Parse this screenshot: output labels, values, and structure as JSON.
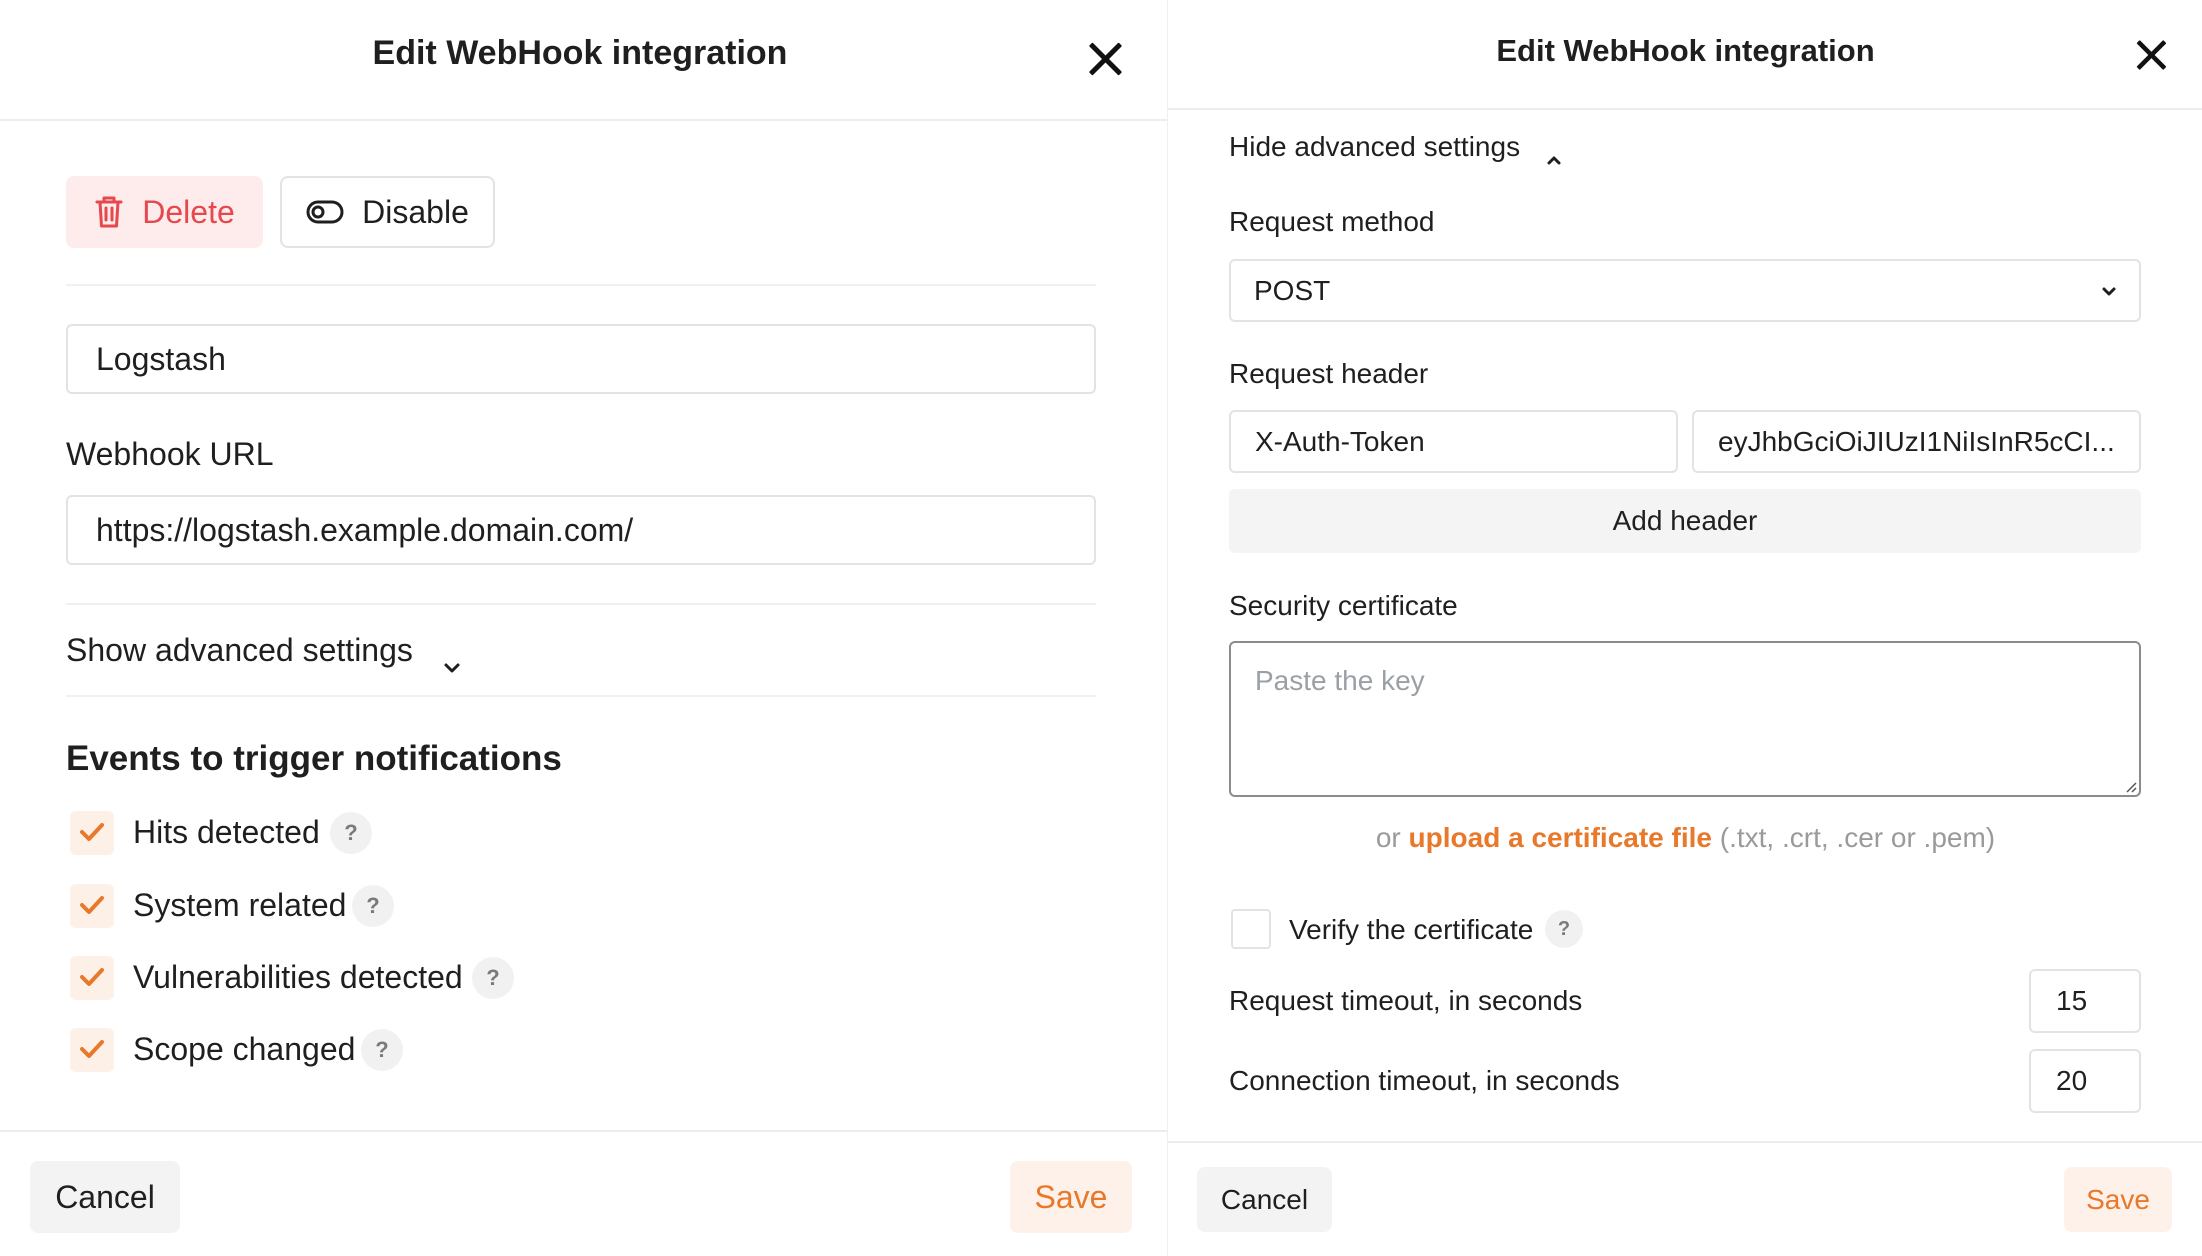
{
  "left": {
    "title": "Edit WebHook integration",
    "delete_label": "Delete",
    "disable_label": "Disable",
    "name_value": "Logstash",
    "url_label": "Webhook URL",
    "url_value": "https://logstash.example.domain.com/",
    "advanced_toggle": "Show advanced settings",
    "events_heading": "Events to trigger notifications",
    "events": [
      {
        "label": "Hits detected",
        "checked": true
      },
      {
        "label": "System related",
        "checked": true
      },
      {
        "label": "Vulnerabilities detected",
        "checked": true
      },
      {
        "label": "Scope changed",
        "checked": true
      }
    ],
    "help_glyph": "?",
    "cancel_label": "Cancel",
    "save_label": "Save"
  },
  "right": {
    "title": "Edit WebHook integration",
    "advanced_toggle": "Hide advanced settings",
    "method_label": "Request method",
    "method_value": "POST",
    "header_label": "Request header",
    "header_name": "X-Auth-Token",
    "header_value": "eyJhbGciOiJIUzI1NiIsInR5cCI...",
    "add_header_label": "Add header",
    "cert_label": "Security certificate",
    "cert_placeholder": "Paste the key",
    "upload_prefix": "or",
    "upload_link": "upload a certificate file",
    "upload_suffix": "(.txt, .crt, .cer or .pem)",
    "verify_label": "Verify the certificate",
    "verify_checked": false,
    "help_glyph": "?",
    "request_timeout_label": "Request timeout, in seconds",
    "request_timeout_value": "15",
    "connection_timeout_label": "Connection timeout, in seconds",
    "connection_timeout_value": "20",
    "cancel_label": "Cancel",
    "save_label": "Save"
  },
  "colors": {
    "accent": "#e8782a",
    "delete_red": "#e5484d",
    "delete_bg": "#fdeceb",
    "save_bg": "#fdf1e9",
    "checkbox_bg": "#fdf0e7"
  },
  "icons": [
    "close-icon",
    "trash-icon",
    "toggle-off-icon",
    "chevron-down-icon",
    "chevron-up-icon",
    "check-icon",
    "help-icon",
    "resize-handle-icon"
  ]
}
